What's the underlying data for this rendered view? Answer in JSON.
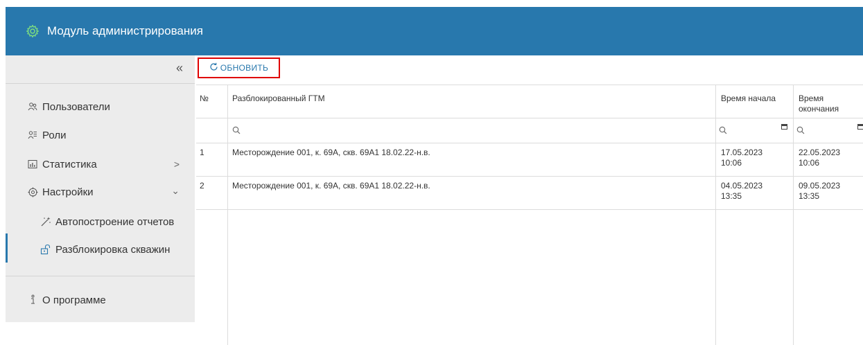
{
  "header": {
    "title": "Модуль администрирования",
    "icon": "gear-icon",
    "bg_color": "#2878ad"
  },
  "sidebar": {
    "collapse_label": "«",
    "items": [
      {
        "label": "Пользователи",
        "icon": "users-icon"
      },
      {
        "label": "Роли",
        "icon": "roles-icon"
      },
      {
        "label": "Статистика",
        "icon": "chart-icon",
        "chevron": ">"
      },
      {
        "label": "Настройки",
        "icon": "settings-icon",
        "chevron": "⌄"
      }
    ],
    "sub_items": [
      {
        "label": "Автопостроение отчетов",
        "icon": "magic-wand-icon"
      },
      {
        "label": "Разблокировка скважин",
        "icon": "unlock-icon",
        "active": true
      }
    ],
    "about": {
      "label": "О программе",
      "icon": "info-icon"
    }
  },
  "toolbar": {
    "refresh_label": "ОБНОВИТЬ",
    "refresh_icon": "refresh-icon",
    "highlight_color": "#e00000"
  },
  "table": {
    "columns": [
      "№",
      "Разблокированный ГТМ",
      "Время начала",
      "Время окончания"
    ],
    "col4_line1": "Время",
    "col4_line2": "окончания",
    "rows": [
      {
        "num": "1",
        "gtm": "Месторождение 001, к. 69А, скв. 69А1 18.02.22-н.в.",
        "start_date": "17.05.2023",
        "start_time": "10:06",
        "end_date": "22.05.2023",
        "end_time": "10:06"
      },
      {
        "num": "2",
        "gtm": "Месторождение 001, к. 69А, скв. 69А1 18.02.22-н.в.",
        "start_date": "04.05.2023",
        "start_time": "13:35",
        "end_date": "09.05.2023",
        "end_time": "13:35"
      }
    ]
  }
}
